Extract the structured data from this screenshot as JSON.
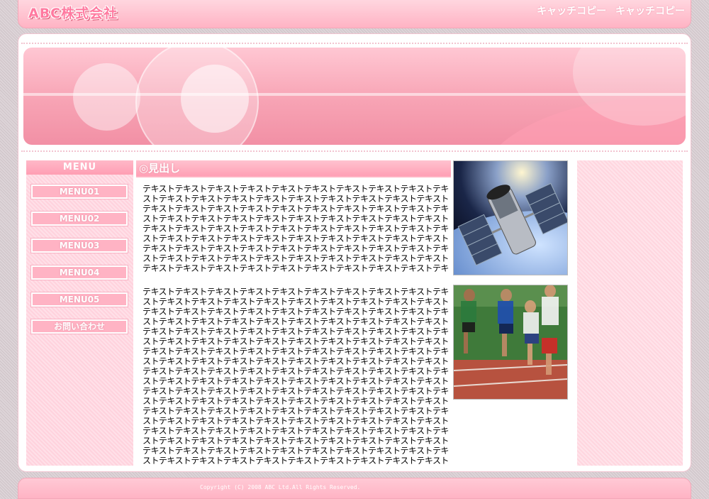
{
  "header": {
    "logo": "ABC株式会社",
    "catch_copy": [
      "キャッチコピー",
      "キャッチコピー"
    ]
  },
  "sidebar": {
    "title": "MENU",
    "items": [
      {
        "label": "MENU01"
      },
      {
        "label": "MENU02"
      },
      {
        "label": "MENU03"
      },
      {
        "label": "MENU04"
      },
      {
        "label": "MENU05"
      },
      {
        "label": "お問い合わせ"
      }
    ]
  },
  "content": {
    "heading": "◎見出し",
    "paragraphs": [
      "テキストテキストテキストテキストテキストテキストテキストテキストテキストテキストテキストテキストテキストテキストテキストテキストテキストテキストテキストテキストテキストテキストテキストテキストテキストテキストテキストテキストテキストテキストテキストテキストテキストテキストテキストテキストテキストテキストテキストテキストテキストテキストテキストテキストテキストテキストテキストテキストテキストテキストテキストテキストテキストテキストテキストテキストテキストテキストテキストテキストテキストテキストテキストテキストテキストテキストテキストテキストテキストテキストテキストテキストテキストテキストテキストテキストテキストテキストテキストテキストテキストテキストテキストテキストテキストテキストテキストテキストテキストテキスト",
      "テキストテキストテキストテキストテキストテキストテキストテキストテキストテキストテキストテキストテキストテキストテキストテキストテキストテキストテキストテキストテキストテキストテキストテキストテキストテキストテキストテキストテキストテキストテキストテキストテキストテキストテキストテキストテキストテキストテキストテキストテキストテキストテキストテキストテキストテキストテキストテキストテキストテキストテキストテキストテキストテキストテキストテキストテキストテキストテキストテキストテキストテキストテキストテキストテキストテキストテキストテキストテキストテキストテキストテキストテキストテキストテキストテキストテキストテキストテキストテキストテキストテキストテキストテキストテキストテキストテキストテキストテキストテキストテキストテキストテキストテキストテキストテキストテキストテキストテキストテキストテキストテキストテキストテキストテキストテキストテキストテキストテキストテキストテキストテキストテキストテキストテキストテキストテキストテキストテキストテキストテキストテキストテキストテキストテキストテキストテキストテキストテキストテキストテキストテキストテキストテキストテキストテキストテキストテキストテキストテキストテキストテキストテキストテキストテキストテキストテキストテキストテキストテキストテキストテキストテキストテキストテキストテキストテキストテキストテキストテキストテキストテキストテキストテキストテキストテキストテキストテキストテキストテキストテキストテキストテキストテキストテキストテキストテキストテキストテキストテキストテキストテキストテキストテキストテキストテキストテキストテキストテキストテキストテキストテキストテキストテキストテキストテキストテキストテキストテキストテキスト"
    ]
  },
  "images": [
    "satellite-photo",
    "runners-photo"
  ],
  "footer": {
    "copyright": "Copyright (C) 2008 ABC Ltd.All Rights Reserved."
  },
  "colors": {
    "accent": "#ffb3c4",
    "accent_dark": "#f290a5",
    "text": "#000000"
  }
}
